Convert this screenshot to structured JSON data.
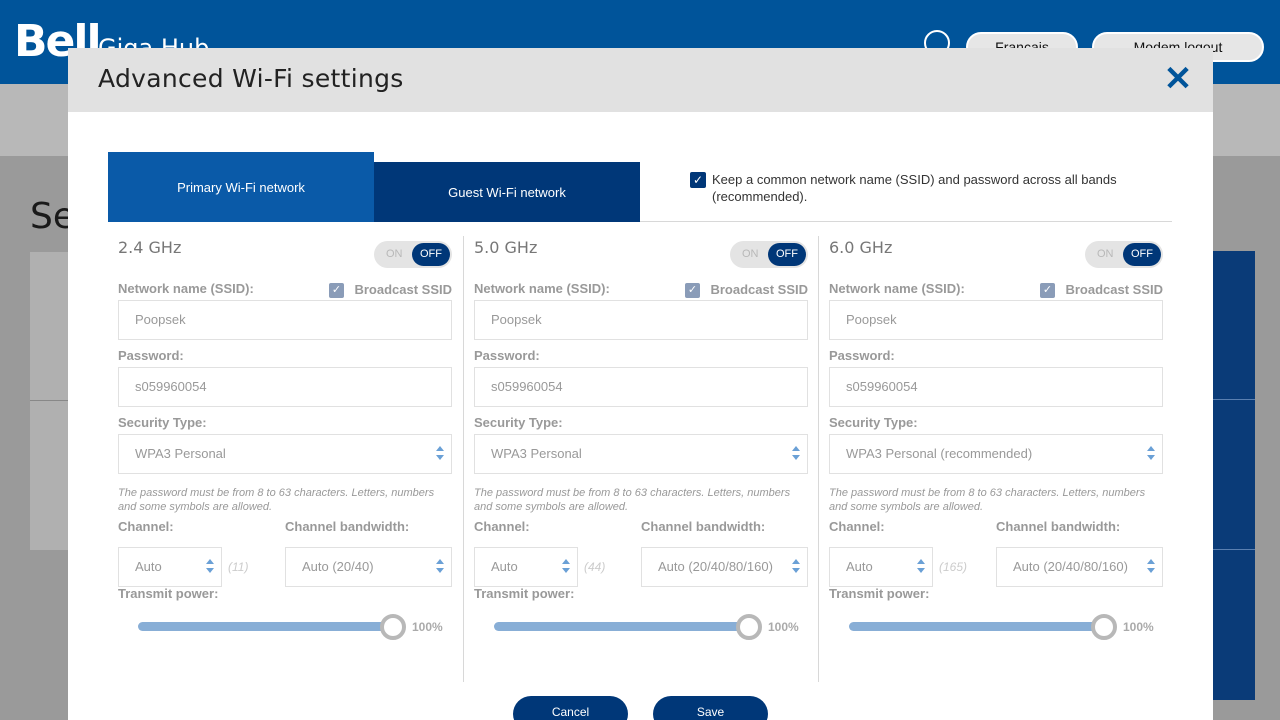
{
  "background": {
    "logo": "Bell",
    "hub_title": "Giga Hub",
    "lang_button": "Français",
    "logout_button": "Modem logout",
    "page_title_partial": "Se"
  },
  "modal": {
    "title": "Advanced Wi-Fi settings",
    "close_glyph": "✕",
    "tabs": {
      "primary": "Primary Wi-Fi network",
      "guest": "Guest Wi-Fi network"
    },
    "common_checkbox_label": "Keep a common network name (SSID) and password across all bands (recommended).",
    "common_checkbox_checked": true,
    "labels": {
      "ssid": "Network name (SSID):",
      "broadcast": "Broadcast SSID",
      "password": "Password:",
      "security": "Security Type:",
      "hint": "The password must be from 8 to 63 characters. Letters, numbers and some symbols are allowed.",
      "channel": "Channel:",
      "bandwidth": "Channel bandwidth:",
      "transmit": "Transmit power:",
      "toggle_on": "ON",
      "toggle_off": "OFF"
    },
    "bands": [
      {
        "name": "2.4 GHz",
        "state": "OFF",
        "ssid": "Poopsek",
        "password": "s059960054",
        "security": "WPA3 Personal",
        "channel": "Auto",
        "channel_num": "(11)",
        "bandwidth": "Auto (20/40)",
        "power": "100%",
        "power_value": 100
      },
      {
        "name": "5.0 GHz",
        "state": "OFF",
        "ssid": "Poopsek",
        "password": "s059960054",
        "security": "WPA3 Personal",
        "channel": "Auto",
        "channel_num": "(44)",
        "bandwidth": "Auto (20/40/80/160)",
        "power": "100%",
        "power_value": 100
      },
      {
        "name": "6.0 GHz",
        "state": "OFF",
        "ssid": "Poopsek",
        "password": "s059960054",
        "security": "WPA3 Personal (recommended)",
        "channel": "Auto",
        "channel_num": "(165)",
        "bandwidth": "Auto (20/40/80/160)",
        "power": "100%",
        "power_value": 100
      }
    ],
    "buttons": {
      "cancel": "Cancel",
      "save": "Save"
    }
  },
  "colors": {
    "brand_blue": "#00549a",
    "dark_blue": "#003778",
    "slider_blue": "#88aed6"
  }
}
